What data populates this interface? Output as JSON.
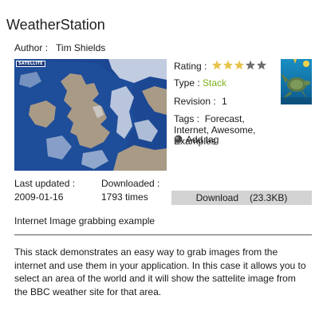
{
  "app": {
    "title": "WeatherStation"
  },
  "author": {
    "label": "Author :",
    "name": "Tim Shields"
  },
  "screenshot": {
    "badge": "SATELLITE",
    "sea_color": "#1e4d99",
    "land_color": "#a99a86",
    "cloud_color": "#dfe4ee"
  },
  "info": {
    "rating_label": "Rating :",
    "rating": 3,
    "rating_max": 5,
    "star_on_color": "#e6c34a",
    "star_off_color": "#6f6f6f",
    "type_label": "Type :",
    "type_value": "Stack",
    "type_color": "#7fb21d",
    "revision_label": "Revision :",
    "revision_value": "1",
    "tags_label": "Tags :",
    "tags_value": "Forecast, Internet, Awesome, Examples",
    "add_tag_label": "Add tag"
  },
  "meta": {
    "updated_label": "Last updated :",
    "updated_value": "2009-01-16",
    "downloaded_label": "Downloaded :",
    "downloaded_value": "1793 times"
  },
  "download": {
    "label": "Download",
    "size": "(23.3KB)",
    "bg_color": "#d3d3d3"
  },
  "summary": "Internet Image grabbing example",
  "description": "This stack demonstrates an easy way to grab images from the internet and use them in your application. In this case it allows you to select an area of the world and it will show the sattelite image from the BBC weather site for that area."
}
